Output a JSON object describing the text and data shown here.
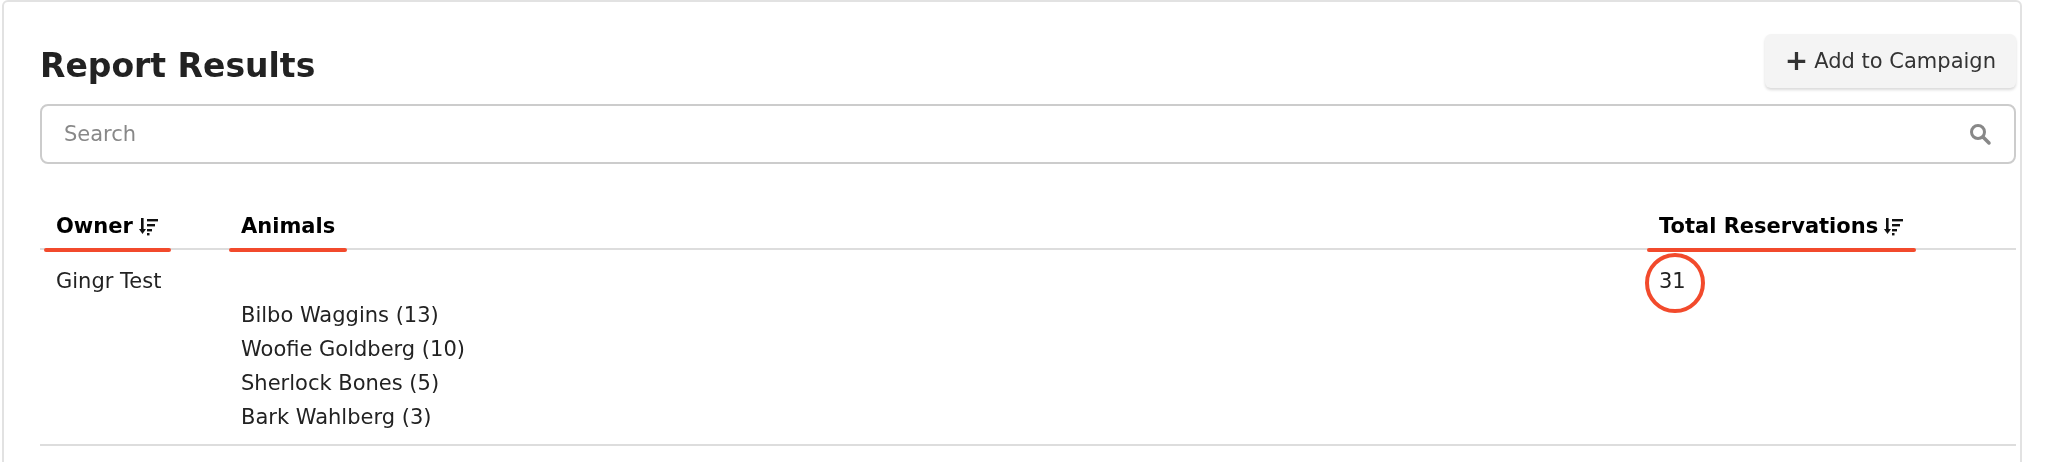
{
  "title": "Report Results",
  "add_button": {
    "icon": "+",
    "label": "Add to Campaign"
  },
  "search": {
    "placeholder": "Search"
  },
  "columns": [
    {
      "label": "Owner",
      "sortable": true,
      "annotated": true
    },
    {
      "label": "Animals",
      "sortable": false,
      "annotated": true
    },
    {
      "label": "Total Reservations",
      "sortable": true,
      "annotated": true
    }
  ],
  "rows": [
    {
      "owner": "Gingr Test",
      "animals": [
        "Bilbo Waggins (13)",
        "Woofie Goldberg (10)",
        "Sherlock Bones (5)",
        "Bark Wahlberg (3)"
      ],
      "total": "31",
      "total_circled": true
    }
  ]
}
